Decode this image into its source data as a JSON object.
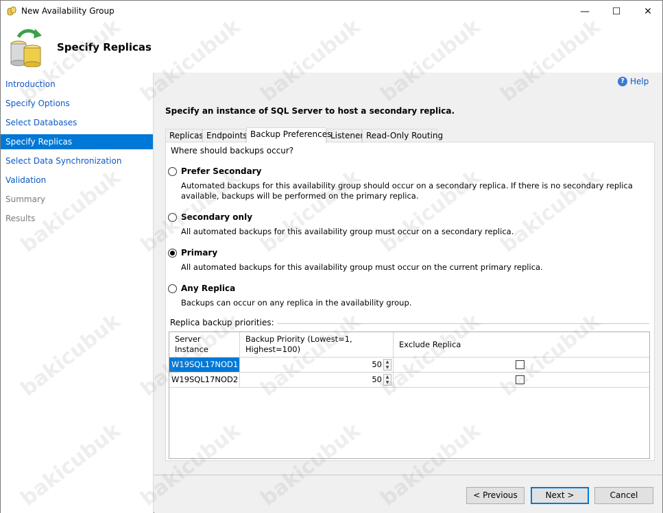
{
  "window": {
    "title": "New Availability Group",
    "minimize_glyph": "—",
    "maximize_glyph": "☐",
    "close_glyph": "✕"
  },
  "header": {
    "title": "Specify Replicas"
  },
  "sidebar": {
    "items": [
      {
        "label": "Introduction",
        "state": "link"
      },
      {
        "label": "Specify Options",
        "state": "link"
      },
      {
        "label": "Select Databases",
        "state": "link"
      },
      {
        "label": "Specify Replicas",
        "state": "selected"
      },
      {
        "label": "Select Data Synchronization",
        "state": "link"
      },
      {
        "label": "Validation",
        "state": "link"
      },
      {
        "label": "Summary",
        "state": "disabled"
      },
      {
        "label": "Results",
        "state": "disabled"
      }
    ]
  },
  "main": {
    "help_label": "Help",
    "instruction": "Specify an instance of SQL Server to host a secondary replica.",
    "tabs": [
      {
        "label": "Replicas",
        "active": false
      },
      {
        "label": "Endpoints",
        "active": false
      },
      {
        "label": "Backup Preferences",
        "active": true
      },
      {
        "label": "Listener",
        "active": false
      },
      {
        "label": "Read-Only Routing",
        "active": false
      }
    ],
    "question": "Where should backups occur?",
    "options": [
      {
        "label": "Prefer Secondary",
        "desc": "Automated backups for this availability group should occur on a secondary replica. If there is no secondary replica available, backups will be performed on the primary replica.",
        "checked": false
      },
      {
        "label": "Secondary only",
        "desc": "All automated backups for this availability group must occur on a secondary replica.",
        "checked": false
      },
      {
        "label": "Primary",
        "desc": "All automated backups for this availability group must occur on the current primary replica.",
        "checked": true
      },
      {
        "label": "Any Replica",
        "desc": "Backups can occur on any replica in the availability group.",
        "checked": false
      }
    ],
    "priorities": {
      "label": "Replica backup priorities:",
      "columns": [
        "Server\nInstance",
        "Backup Priority (Lowest=1,\nHighest=100)",
        "Exclude Replica"
      ],
      "rows": [
        {
          "server": "W19SQL17NOD1",
          "priority": "50",
          "exclude": false,
          "selected": true
        },
        {
          "server": "W19SQL17NOD2",
          "priority": "50",
          "exclude": false,
          "selected": false
        }
      ]
    }
  },
  "buttons": {
    "previous": "< Previous",
    "next": "Next >",
    "cancel": "Cancel"
  },
  "watermark": "bakicubuk",
  "colors": {
    "selection": "#0078d7",
    "link": "#0b58c4",
    "panel_bg": "#f0f0f0"
  }
}
